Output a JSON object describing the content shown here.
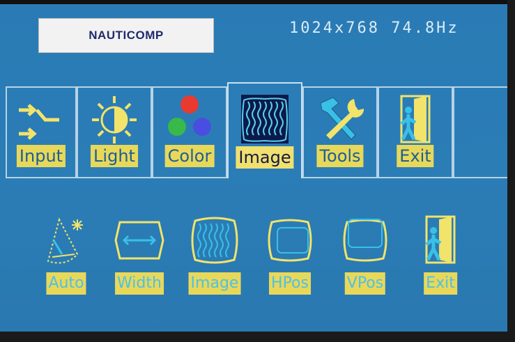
{
  "header": {
    "logo_text": "NAUTICOMP",
    "resolution": "1024x768 74.8Hz"
  },
  "tabs": [
    {
      "label": "Input",
      "icon": "input-arrows-icon",
      "active": false
    },
    {
      "label": "Light",
      "icon": "brightness-sun-icon",
      "active": false
    },
    {
      "label": "Color",
      "icon": "rgb-circles-icon",
      "active": false
    },
    {
      "label": "Image",
      "icon": "image-waves-icon",
      "active": true
    },
    {
      "label": "Tools",
      "icon": "hammer-wrench-icon",
      "active": false
    },
    {
      "label": "Exit",
      "icon": "door-exit-icon",
      "active": false
    }
  ],
  "submenu": [
    {
      "label": "Auto",
      "icon": "auto-adjust-icon"
    },
    {
      "label": "Width",
      "icon": "width-icon"
    },
    {
      "label": "Image",
      "icon": "image-phase-icon"
    },
    {
      "label": "HPos",
      "icon": "hposition-icon"
    },
    {
      "label": "VPos",
      "icon": "vposition-icon"
    },
    {
      "label": "Exit",
      "icon": "door-exit-icon"
    }
  ],
  "colors": {
    "background": "#2a7bb5",
    "label_yellow": "#e8d85a",
    "label_text": "#4fc0e6",
    "tab_border": "#b7d3e6"
  }
}
